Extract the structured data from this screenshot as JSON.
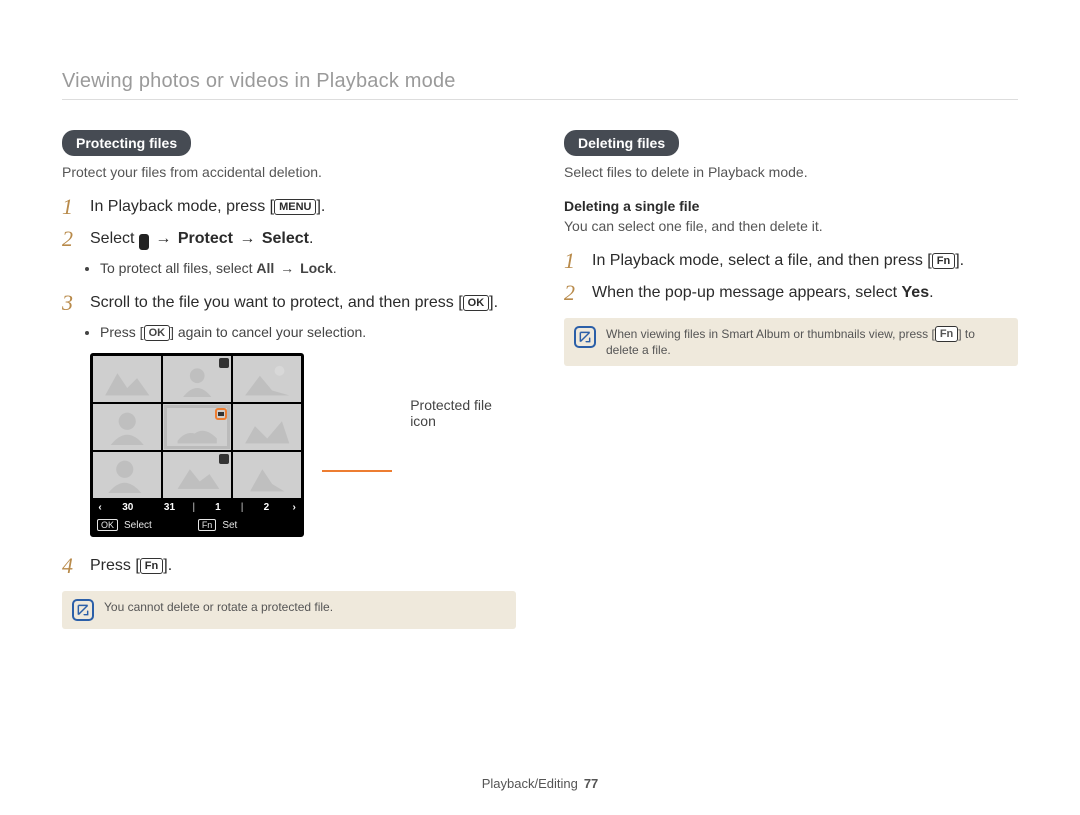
{
  "header": {
    "title": "Viewing photos or videos in Playback mode"
  },
  "left": {
    "pill": "Protecting files",
    "desc": "Protect your files from accidental deletion.",
    "step1_a": "In Playback mode, press [",
    "step1_btn": "MENU",
    "step1_b": "].",
    "step2_a": "Select ",
    "step2_b": " → ",
    "step2_protect": "Protect",
    "step2_c": " → ",
    "step2_select": "Select",
    "step2_d": ".",
    "bullet1_a": "To protect all files, select ",
    "bullet1_all": "All",
    "bullet1_b": " → ",
    "bullet1_lock": "Lock",
    "bullet1_c": ".",
    "step3_a": "Scroll to the file you want to protect, and then press [",
    "step3_btn": "OK",
    "step3_b": "].",
    "bullet2_a": "Press [",
    "bullet2_btn": "OK",
    "bullet2_b": "] again to cancel your selection.",
    "callout": "Protected file icon",
    "datebar": {
      "d1": "30",
      "d2": "31",
      "d3": "1",
      "d4": "2"
    },
    "cmdbar": {
      "k1": "OK",
      "t1": "Select",
      "k2": "Fn",
      "t2": "Set"
    },
    "step4_a": "Press [",
    "step4_btn": "Fn",
    "step4_b": "].",
    "note": "You cannot delete or rotate a protected file."
  },
  "right": {
    "pill": "Deleting files",
    "desc": "Select files to delete in Playback mode.",
    "subhead": "Deleting a single file",
    "subtext": "You can select one file, and then delete it.",
    "step1_a": "In Playback mode, select a file, and then press [",
    "step1_btn": "Fn",
    "step1_b": "].",
    "step2_a": "When the pop-up message appears, select ",
    "step2_yes": "Yes",
    "step2_b": ".",
    "note_a": "When viewing files in Smart Album or thumbnails view, press [",
    "note_btn": "Fn",
    "note_b": "] to delete a file."
  },
  "footer": {
    "section": "Playback/Editing",
    "page": "77"
  }
}
